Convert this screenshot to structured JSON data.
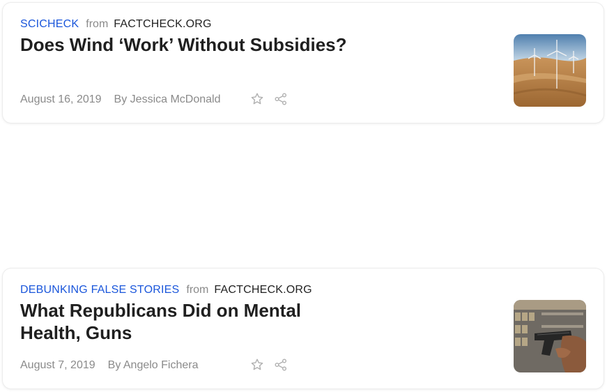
{
  "articles": [
    {
      "category": "SCICHECK",
      "from_label": "from",
      "source": "FACTCHECK.ORG",
      "title": "Does Wind ‘Work’ Without Subsidies?",
      "date": "August 16, 2019",
      "author": "By Jessica McDonald",
      "thumbnail_icon": "wind-turbines-image"
    },
    {
      "category": "DEBUNKING FALSE STORIES",
      "from_label": "from",
      "source": "FACTCHECK.ORG",
      "title": "What Republicans Did on Mental Health, Guns",
      "date": "August 7, 2019",
      "author": "By Angelo Fichera",
      "thumbnail_icon": "handgun-image"
    }
  ],
  "icons": {
    "save": "star-icon",
    "share": "share-icon"
  },
  "colors": {
    "category": "#1a56db",
    "title": "#1f1f1f",
    "muted": "#8a8a8a"
  }
}
